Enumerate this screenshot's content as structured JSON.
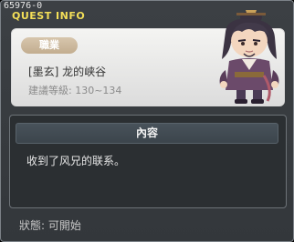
{
  "window": {
    "id_text": "65976-0",
    "title": "QUEST INFO"
  },
  "job_panel": {
    "badge": "職業",
    "quest_name": "[墨玄] 龙的峡谷",
    "level_text": "建議等級: 130~134"
  },
  "portrait": {
    "icon": "character-portrait"
  },
  "content": {
    "header": "內容",
    "text": "收到了风兄的联系。"
  },
  "status": {
    "text": "狀態: 可開始"
  },
  "colors": {
    "title": "#f3df58",
    "badge": "#c9b496",
    "panel_bg": "#2b2f32",
    "window_bg": "#3c4044"
  }
}
